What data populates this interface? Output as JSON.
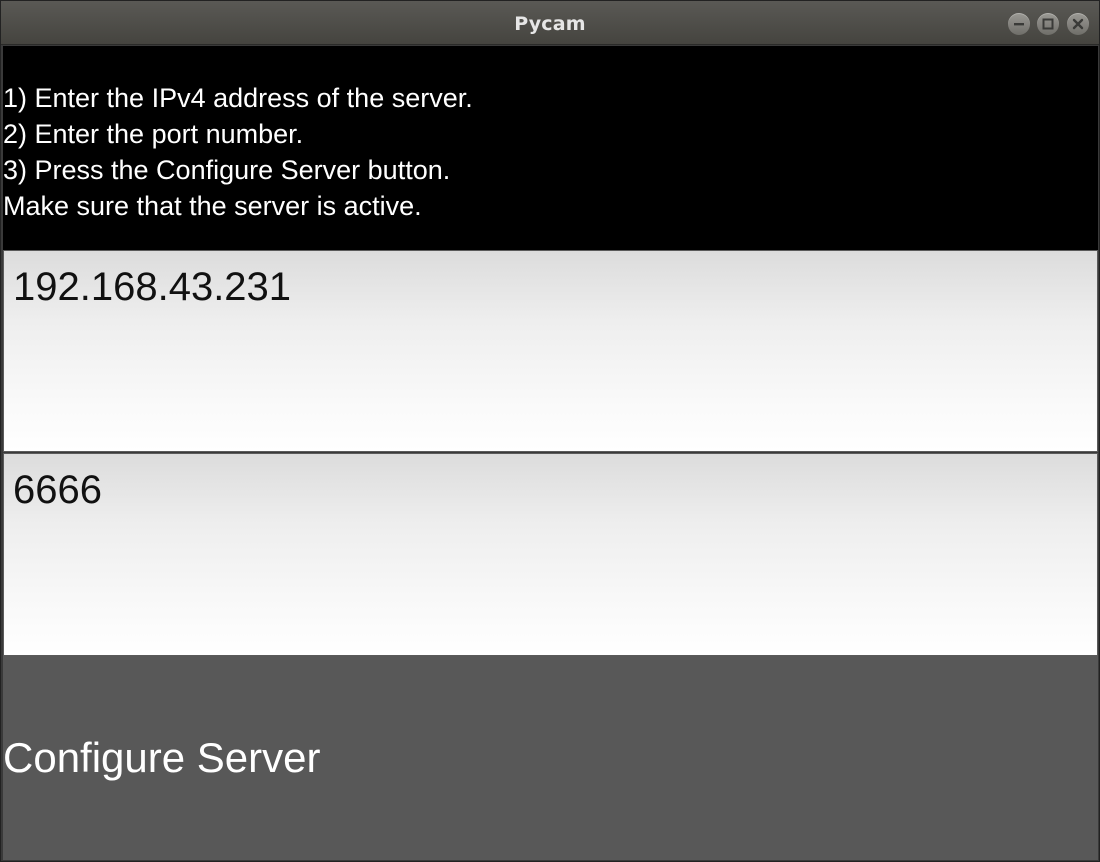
{
  "window": {
    "title": "Pycam"
  },
  "instructions": [
    "1) Enter the IPv4 address of the server.",
    "2) Enter the port number.",
    "3) Press the Configure Server button.",
    "Make sure that the server is active."
  ],
  "server": {
    "ip_value": "192.168.43.231",
    "port_value": "6666"
  },
  "configure_button": {
    "label": "Configure Server"
  },
  "colors": {
    "instructions_bg": "#000000",
    "button_bg": "#585858",
    "titlebar": "#4f4e4a"
  }
}
